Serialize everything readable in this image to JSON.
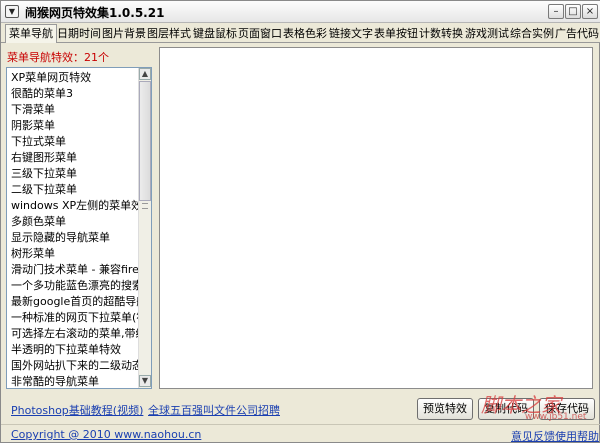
{
  "window": {
    "title": "闹猴网页特效集1.0.5.21",
    "icon_glyph": "▼",
    "controls": {
      "minimize": "–",
      "maximize": "□",
      "close": "×"
    }
  },
  "tabs": [
    {
      "label": "菜单导航",
      "active": true
    },
    {
      "label": "日期时间"
    },
    {
      "label": "图片背景"
    },
    {
      "label": "图层样式"
    },
    {
      "label": "键盘鼠标"
    },
    {
      "label": "页面窗口"
    },
    {
      "label": "表格色彩"
    },
    {
      "label": "链接文字"
    },
    {
      "label": "表单按钮"
    },
    {
      "label": "计数转换"
    },
    {
      "label": "游戏测试"
    },
    {
      "label": "综合实例"
    },
    {
      "label": "广告代码"
    }
  ],
  "sidebar": {
    "header": "菜单导航特效：21个",
    "items": [
      "XP菜单网页特效",
      "很酷的菜单3",
      "下滑菜单",
      "阴影菜单",
      "下拉式菜单",
      "右键图形菜单",
      "三级下拉菜单",
      "二级下拉菜单",
      "windows XP左侧的菜单效果",
      "多颜色菜单",
      "显示隐藏的导航菜单",
      "树形菜单",
      "滑动门技术菜单 - 兼容firefox火",
      "一个多功能蓝色漂亮的搜索条",
      "最新google首页的超酷导航效果",
      "一种标准的网页下拉菜单(符合",
      "可选择左右滚动的菜单,带缓动",
      "半透明的下拉菜单特效",
      "国外网站扒下来的二级动态导航",
      "非常酷的导航菜单"
    ],
    "scroll_up": "▲",
    "scroll_down": "▼"
  },
  "bottom": {
    "link_left": "Photoshop基础教程(视频)",
    "link_mid": "全球五百强叫文件公司招聘",
    "btn_preview": "预览特效",
    "btn_copy": "复制代码",
    "btn_save": "保存代码",
    "copyright": "Copyright @ 2010 www.naohou.cn",
    "feedback": "意见反馈",
    "help": "使用帮助"
  },
  "watermark": {
    "text": "脚本之家",
    "sub": "www.jb51.net"
  }
}
